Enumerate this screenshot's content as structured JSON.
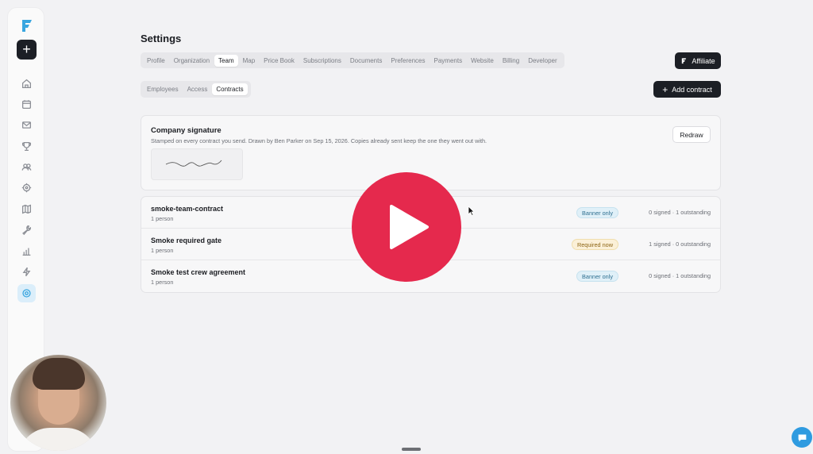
{
  "page": {
    "title": "Settings"
  },
  "tabs": [
    {
      "label": "Profile",
      "active": false
    },
    {
      "label": "Organization",
      "active": false
    },
    {
      "label": "Team",
      "active": true
    },
    {
      "label": "Map",
      "active": false
    },
    {
      "label": "Price Book",
      "active": false
    },
    {
      "label": "Subscriptions",
      "active": false
    },
    {
      "label": "Documents",
      "active": false
    },
    {
      "label": "Preferences",
      "active": false
    },
    {
      "label": "Payments",
      "active": false
    },
    {
      "label": "Website",
      "active": false
    },
    {
      "label": "Billing",
      "active": false
    },
    {
      "label": "Developer",
      "active": false
    }
  ],
  "subtabs": [
    {
      "label": "Employees",
      "active": false
    },
    {
      "label": "Access",
      "active": false
    },
    {
      "label": "Contracts",
      "active": true
    }
  ],
  "buttons": {
    "affiliate_label": "Affiliate",
    "add_contract_label": "Add contract",
    "redraw_label": "Redraw"
  },
  "signature": {
    "title": "Company signature",
    "description": "Stamped on every contract you send. Drawn by Ben Parker on Sep 15, 2026. Copies already sent keep the one they went out with."
  },
  "contracts": [
    {
      "name": "smoke-team-contract",
      "subtitle": "1 person",
      "badge": "Banner only",
      "badge_type": "banner",
      "stats": "0 signed · 1 outstanding"
    },
    {
      "name": "Smoke required gate",
      "subtitle": "1 person",
      "badge": "Required now",
      "badge_type": "required",
      "stats": "1 signed · 0 outstanding"
    },
    {
      "name": "Smoke test crew agreement",
      "subtitle": "1 person",
      "badge": "Banner only",
      "badge_type": "banner",
      "stats": "0 signed · 1 outstanding"
    }
  ],
  "sidebar": {
    "icons": [
      "home-icon",
      "calendar-icon",
      "mail-icon",
      "trophy-icon",
      "team-icon",
      "target-icon",
      "map-icon",
      "wrench-icon",
      "chart-icon",
      "lightning-icon",
      "settings-icon"
    ],
    "active_icon": "settings-icon"
  },
  "video_overlay": {
    "play_icon": "play-icon",
    "color": "#e5294d"
  },
  "colors": {
    "accent": "#38a5df",
    "dark_button": "#1c1f25",
    "background": "#f2f2f4"
  }
}
